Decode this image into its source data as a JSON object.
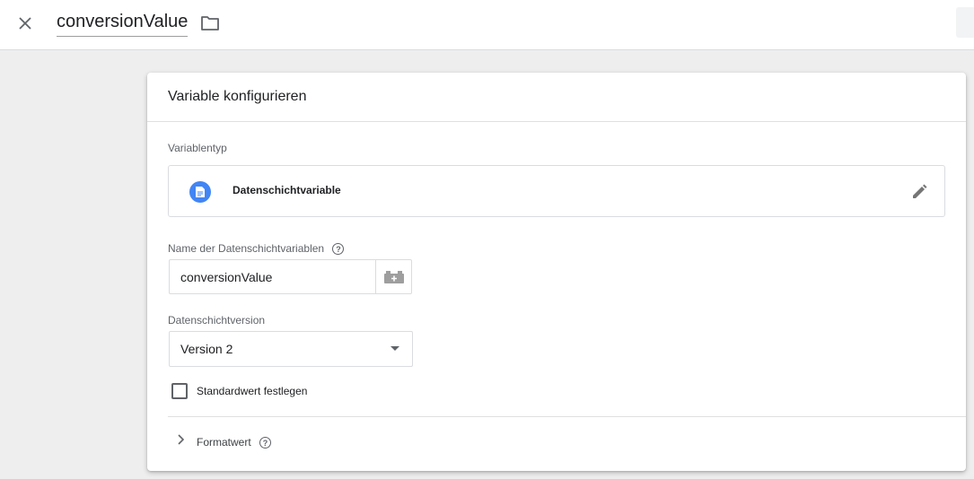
{
  "header": {
    "title": "conversionValue",
    "close_icon": "close-icon",
    "folder_icon": "folder-icon"
  },
  "card": {
    "title": "Variable konfigurieren",
    "variable_type": {
      "label": "Variablentyp",
      "name": "Datenschichtvariable",
      "icon": "document-icon",
      "icon_color": "#4285f4",
      "edit_icon": "pencil-icon"
    },
    "name_field": {
      "label": "Name der Datenschichtvariablen",
      "value": "conversionValue",
      "picker_icon": "variable-picker-icon"
    },
    "version_field": {
      "label": "Datenschichtversion",
      "selected": "Version 2"
    },
    "default_value": {
      "label": "Standardwert festlegen",
      "checked": false
    },
    "format_value": {
      "label": "Formatwert",
      "expanded": false
    }
  }
}
